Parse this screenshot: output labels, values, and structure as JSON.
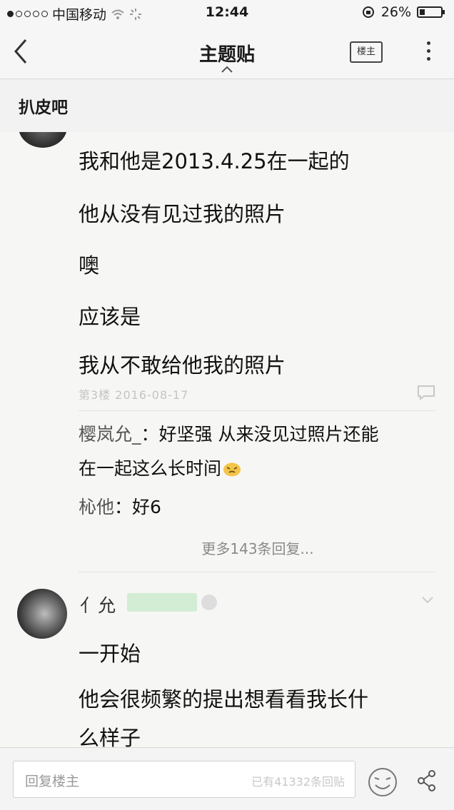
{
  "status_bar": {
    "carrier": "中国移动",
    "time": "12:44",
    "battery_text": "26%",
    "battery_level": 0.26
  },
  "nav": {
    "title": "主题贴",
    "owner_button": "楼主"
  },
  "forum": {
    "name": "扒皮吧"
  },
  "post": {
    "lines": [
      "我和他是2013.4.25在一起的",
      "他从没有见过我的照片",
      "噢",
      "应该是",
      "我从不敢给他我的照片"
    ],
    "meta": "第3楼   2016-08-17"
  },
  "replies": [
    {
      "user": "樱岚允_",
      "text": "好坚强 从来没见过照片还能"
    },
    {
      "user": "",
      "text": "在一起这么长时间"
    },
    {
      "user": "杺他",
      "text": "好6"
    }
  ],
  "more_replies": "更多143条回复...",
  "next_post": {
    "user": "亻允",
    "lines": [
      "一开始",
      "他会很频繁的提出想看看我长什",
      "么样子"
    ]
  },
  "bottom": {
    "reply_placeholder": "回复楼主",
    "reply_count": "已有41332条回贴"
  },
  "colors": {
    "level_badge": "#d3ecd4",
    "background": "#f6f6f4"
  }
}
